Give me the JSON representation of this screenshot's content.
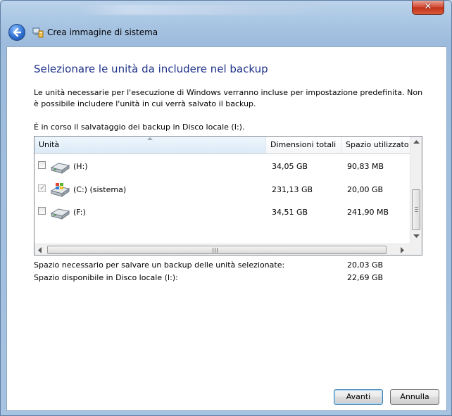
{
  "window": {
    "close_label": "✕",
    "title": "Crea immagine di sistema"
  },
  "page": {
    "heading": "Selezionare le unità da includere nel backup",
    "description": "Le unità necessarie per l'esecuzione di Windows verranno incluse per impostazione predefinita. Non è possibile includere l'unità in cui verrà salvato il backup.",
    "save_info": "È in corso il salvataggio dei backup in Disco locale (I:)."
  },
  "table": {
    "columns": [
      "Unità",
      "Dimensioni totali",
      "Spazio utilizzato"
    ],
    "rows": [
      {
        "name": "(H:)",
        "size": "34,05 GB",
        "used": "90,83 MB",
        "checked": false,
        "icon": "hard-drive-icon"
      },
      {
        "name": "(C:) (sistema)",
        "size": "231,13 GB",
        "used": "20,00 GB",
        "checked": true,
        "icon": "windows-drive-icon"
      },
      {
        "name": "(F:)",
        "size": "34,51 GB",
        "used": "241,90 MB",
        "checked": false,
        "icon": "hard-drive-icon"
      }
    ]
  },
  "summary": {
    "needed_label": "Spazio necessario per salvare un backup delle unità selezionate:",
    "needed_value": "20,03 GB",
    "available_label": "Spazio disponibile in Disco locale (I:):",
    "available_value": "22,69 GB"
  },
  "buttons": {
    "next": "Avanti",
    "cancel": "Annulla"
  },
  "colors": {
    "heading": "#1e3287",
    "frame": "#a9c6e4",
    "default_button_border": "#3c7fb1"
  }
}
